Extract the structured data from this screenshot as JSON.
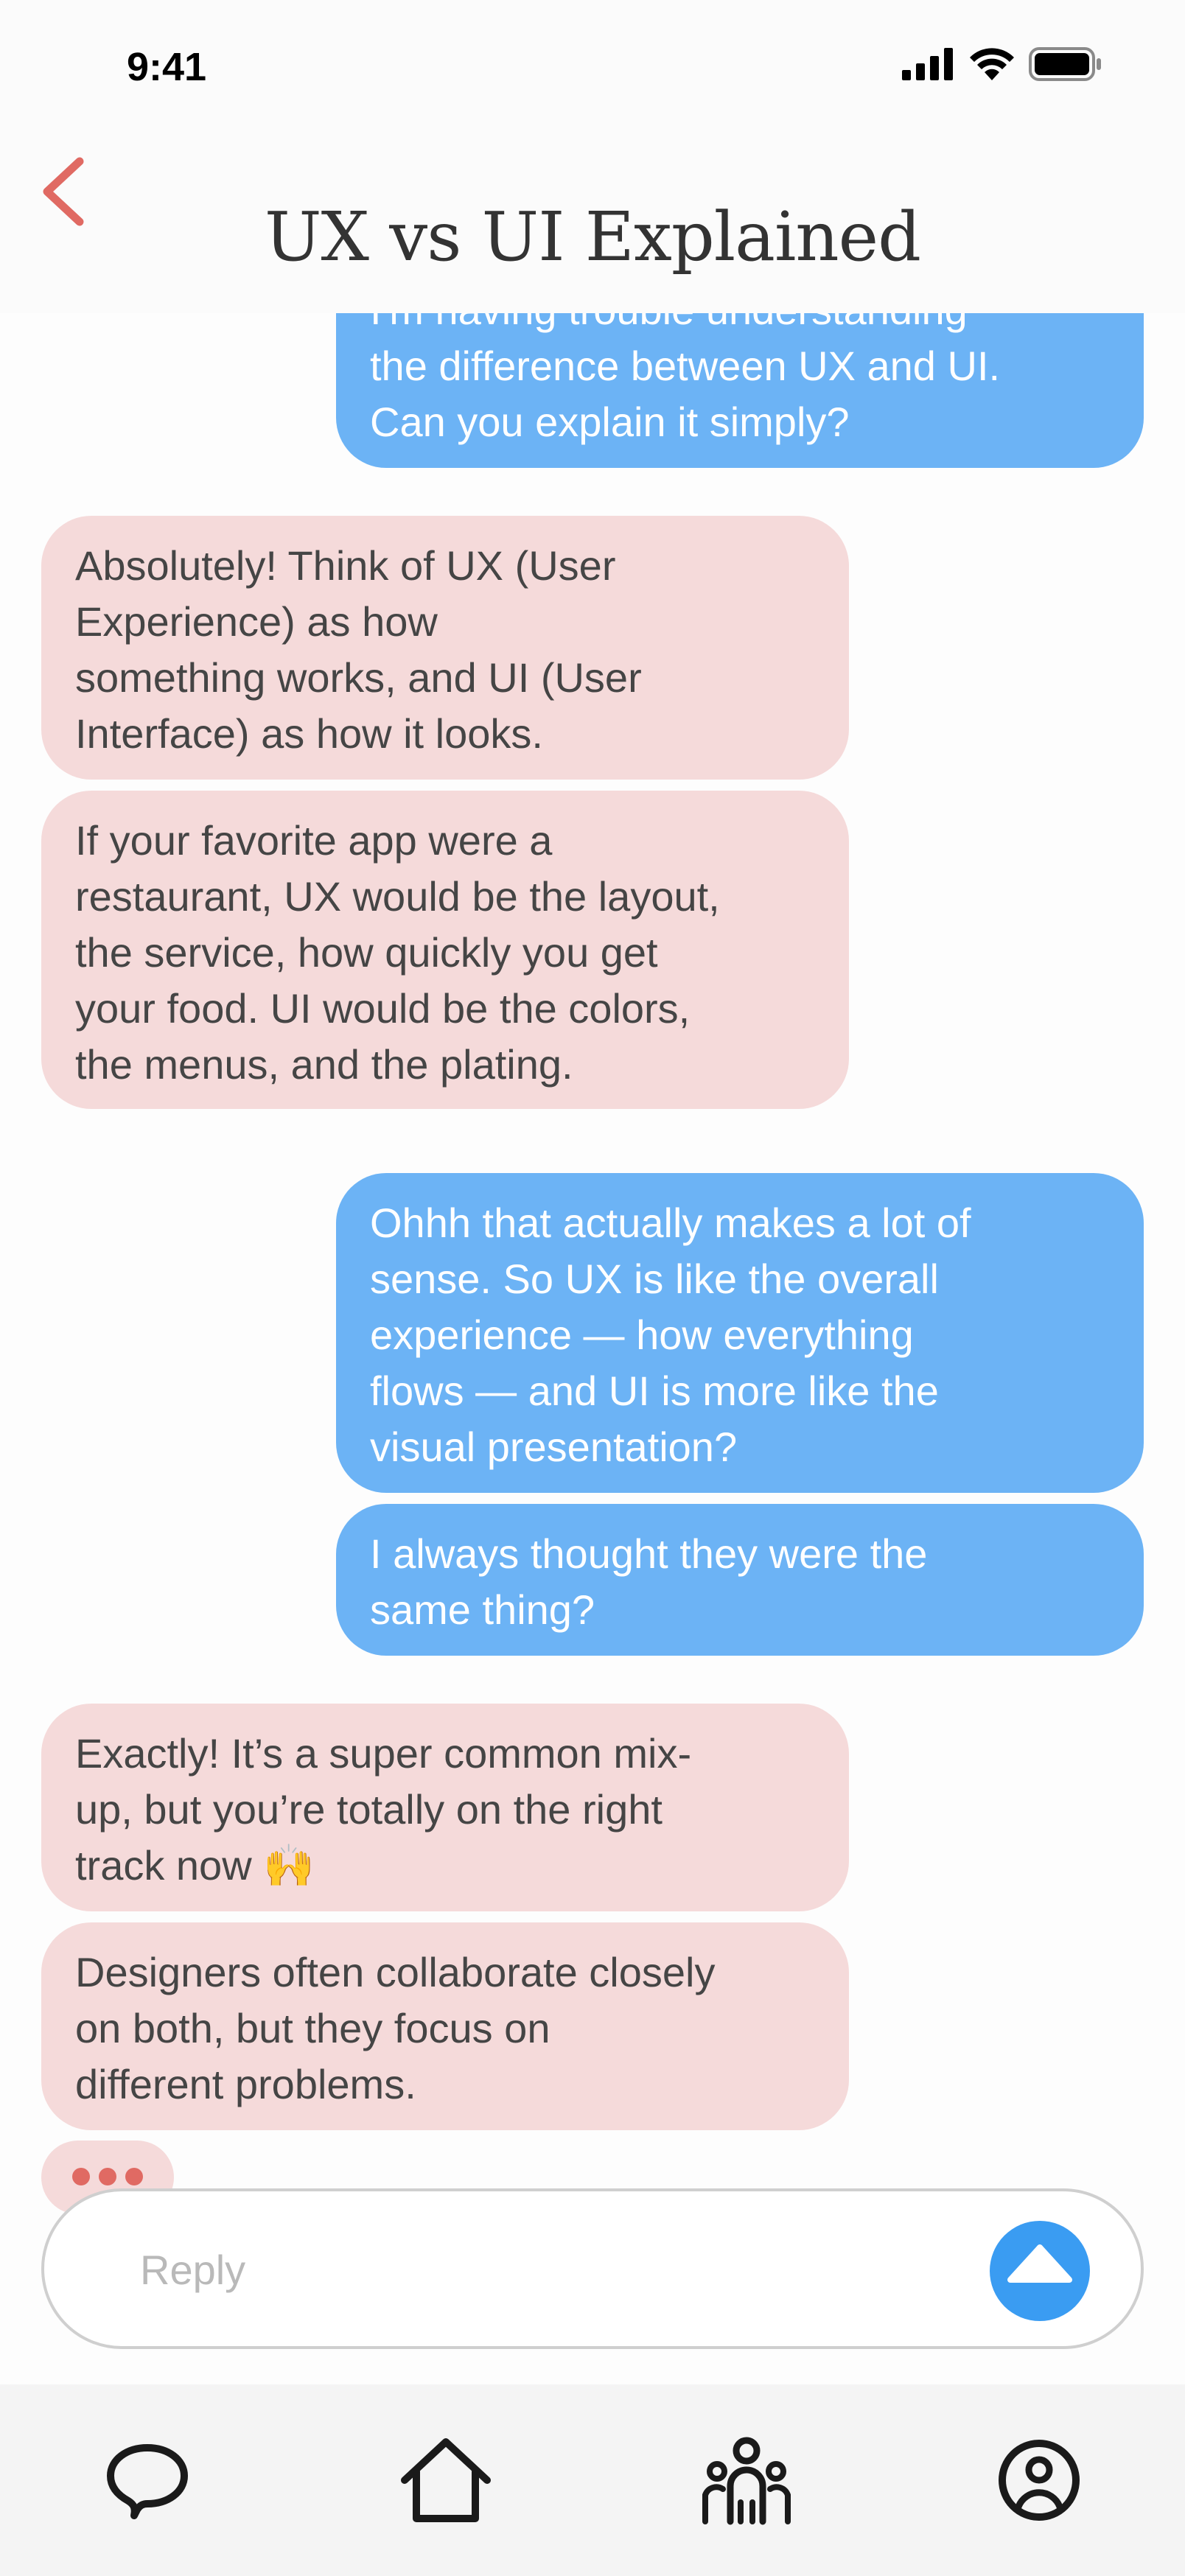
{
  "status_bar": {
    "time": "9:41",
    "icons": [
      "signal-icon",
      "wifi-icon",
      "battery-icon"
    ]
  },
  "header": {
    "title": "UX vs UI Explained",
    "back_icon": "chevron-left-icon"
  },
  "colors": {
    "accent": "#e06a63",
    "ai_bubble": "#f5dada",
    "user_bubble": "#6cb3f5",
    "send_button": "#3a9cf2"
  },
  "messages": [
    {
      "sender": "user",
      "text": "I'm having trouble understanding\nthe difference between UX and UI.\nCan you explain it simply?"
    },
    {
      "sender": "ai",
      "text": "Absolutely! Think of UX (User\nExperience) as how\nsomething works, and UI (User\nInterface) as how it looks."
    },
    {
      "sender": "ai",
      "text": "If your favorite app were a\nrestaurant, UX would be the layout,\nthe service, how quickly you get\nyour food. UI would be the colors,\nthe menus, and the plating."
    },
    {
      "sender": "user",
      "text": "Ohhh that actually makes a lot of\nsense. So UX is like the overall\nexperience — how everything\nflows — and UI is more like the\nvisual presentation?"
    },
    {
      "sender": "user",
      "text": "I always thought they were the\nsame thing?"
    },
    {
      "sender": "ai",
      "text": "Exactly! It’s a super common mix-\nup, but you’re totally on the right\ntrack now 🙌"
    },
    {
      "sender": "ai",
      "text": "Designers often collaborate closely\non both, but they focus on\ndifferent problems."
    }
  ],
  "composer": {
    "placeholder": "Reply",
    "send_icon": "arrow-up-icon"
  },
  "tab_bar": {
    "items": [
      {
        "icon": "chat-bubble-icon"
      },
      {
        "icon": "home-icon"
      },
      {
        "icon": "community-icon"
      },
      {
        "icon": "profile-icon"
      }
    ]
  }
}
